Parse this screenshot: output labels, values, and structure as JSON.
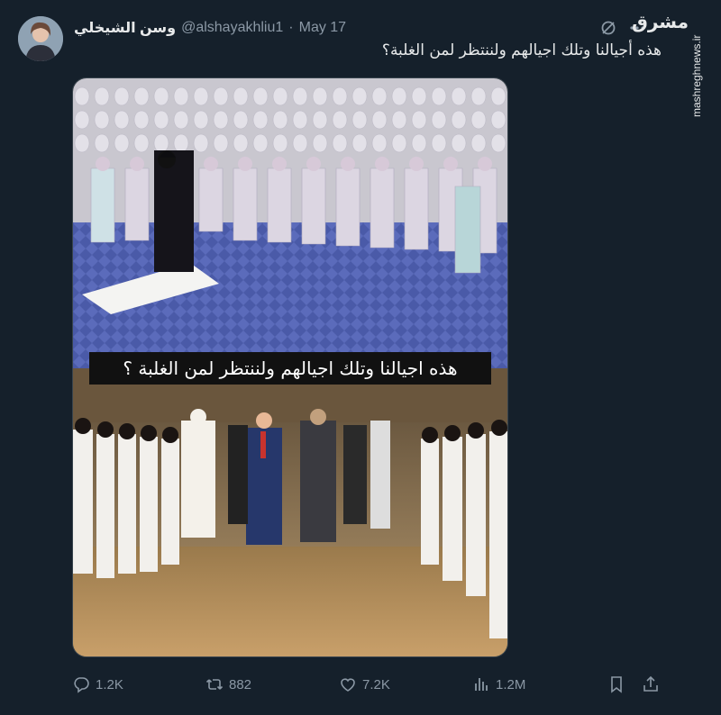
{
  "author": {
    "display_name": "وسن الشيخلي",
    "handle": "@alshayakhliu1",
    "date": "May 17",
    "separator": "·"
  },
  "tweet": {
    "text": "هذه أجيالنا وتلك اجيالهم ولننتظر لمن الغلبة؟",
    "media_caption": "هذه اجيالنا وتلك اجيالهم ولننتظر لمن الغلبة ؟"
  },
  "watermark": {
    "logo_text": "مشرق",
    "site": "mashreghnews.ir"
  },
  "actions": {
    "replies": "1.2K",
    "retweets": "882",
    "likes": "7.2K",
    "views": "1.2M"
  },
  "icons": {
    "more": "more-dots-icon",
    "grok": "grok-icon",
    "reply": "reply-icon",
    "retweet": "retweet-icon",
    "like": "heart-icon",
    "views": "views-chart-icon",
    "bookmark": "bookmark-icon",
    "share": "share-icon"
  },
  "colors": {
    "background": "#15202b",
    "text_primary": "#e7e9ea",
    "text_secondary": "#8b98a5",
    "border": "#38444d"
  }
}
